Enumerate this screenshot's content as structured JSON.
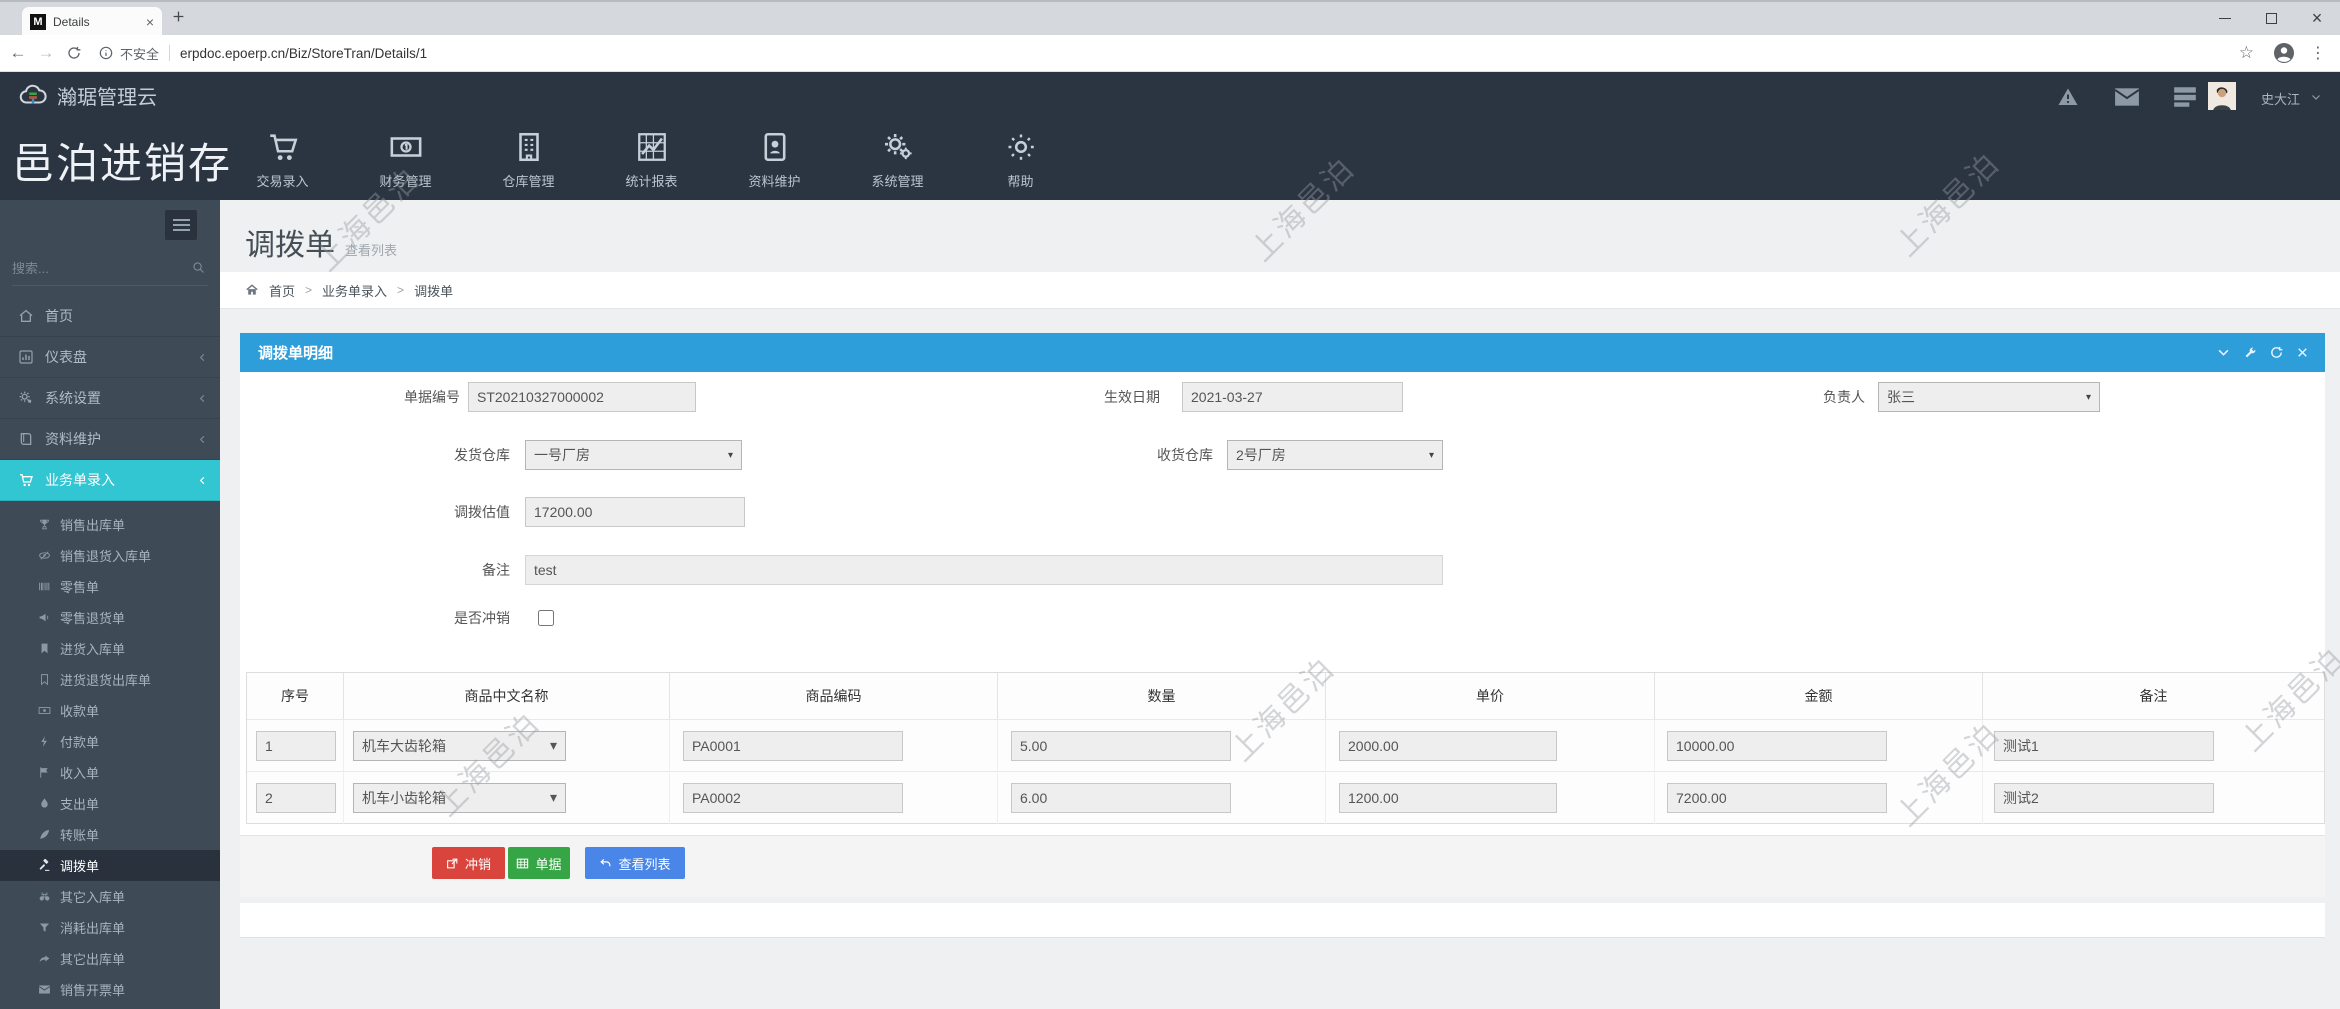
{
  "colors": {
    "accent_teal": "#32c5d2",
    "panel_header_blue": "#2e9edb",
    "button_red": "#d9453c",
    "button_green": "#36a546",
    "button_blue": "#4a86e8"
  },
  "browser": {
    "tab_title": "Details",
    "favicon_letter": "M",
    "security_label": "不安全",
    "url": "erpdoc.epoerp.cn/Biz/StoreTran/Details/1"
  },
  "header": {
    "brand": "瀚琚管理云",
    "user_name": "史大江"
  },
  "topnav": {
    "items": [
      {
        "label": "交易录入",
        "icon": "cart-icon"
      },
      {
        "label": "财务管理",
        "icon": "banknote-icon"
      },
      {
        "label": "仓库管理",
        "icon": "building-icon"
      },
      {
        "label": "统计报表",
        "icon": "report-icon"
      },
      {
        "label": "资料维护",
        "icon": "idcard-icon"
      },
      {
        "label": "系统管理",
        "icon": "gears-icon"
      },
      {
        "label": "帮助",
        "icon": "help-icon"
      }
    ]
  },
  "sidebar": {
    "app_title": "邑泊进销存",
    "search_placeholder": "搜索...",
    "items": [
      {
        "label": "首页"
      },
      {
        "label": "仪表盘"
      },
      {
        "label": "系统设置"
      },
      {
        "label": "资料维护"
      },
      {
        "label": "业务单录入"
      }
    ],
    "subitems": [
      {
        "label": "销售出库单"
      },
      {
        "label": "销售退货入库单"
      },
      {
        "label": "零售单"
      },
      {
        "label": "零售退货单"
      },
      {
        "label": "进货入库单"
      },
      {
        "label": "进货退货出库单"
      },
      {
        "label": "收款单"
      },
      {
        "label": "付款单"
      },
      {
        "label": "收入单"
      },
      {
        "label": "支出单"
      },
      {
        "label": "转账单"
      },
      {
        "label": "调拨单"
      },
      {
        "label": "其它入库单"
      },
      {
        "label": "消耗出库单"
      },
      {
        "label": "其它出库单"
      },
      {
        "label": "销售开票单"
      }
    ]
  },
  "page": {
    "title": "调拨单",
    "subtitle": "查看列表",
    "breadcrumb": [
      "首页",
      "业务单录入",
      "调拨单"
    ],
    "breadcrumb_sep": ">",
    "watermark": "上海邑泊"
  },
  "panel": {
    "title": "调拨单明细",
    "form": {
      "doc_no_label": "单据编号",
      "doc_no": "ST20210327000002",
      "date_label": "生效日期",
      "date": "2021-03-27",
      "owner_label": "负责人",
      "owner": "张三",
      "from_wh_label": "发货仓库",
      "from_wh": "一号厂房",
      "to_wh_label": "收货仓库",
      "to_wh": "2号厂房",
      "value_label": "调拨估值",
      "value": "17200.00",
      "remark_label": "备注",
      "remark": "test",
      "writeoff_label": "是否冲销"
    },
    "table": {
      "headers": [
        "序号",
        "商品中文名称",
        "商品编码",
        "数量",
        "单价",
        "金额",
        "备注"
      ],
      "rows": [
        {
          "seq": "1",
          "name": "机车大齿轮箱",
          "code": "PA0001",
          "qty": "5.00",
          "price": "2000.00",
          "amount": "10000.00",
          "remark": "测试1"
        },
        {
          "seq": "2",
          "name": "机车小齿轮箱",
          "code": "PA0002",
          "qty": "6.00",
          "price": "1200.00",
          "amount": "7200.00",
          "remark": "测试2"
        }
      ]
    },
    "buttons": [
      {
        "label": "冲销"
      },
      {
        "label": "单据"
      },
      {
        "label": "查看列表"
      }
    ]
  }
}
